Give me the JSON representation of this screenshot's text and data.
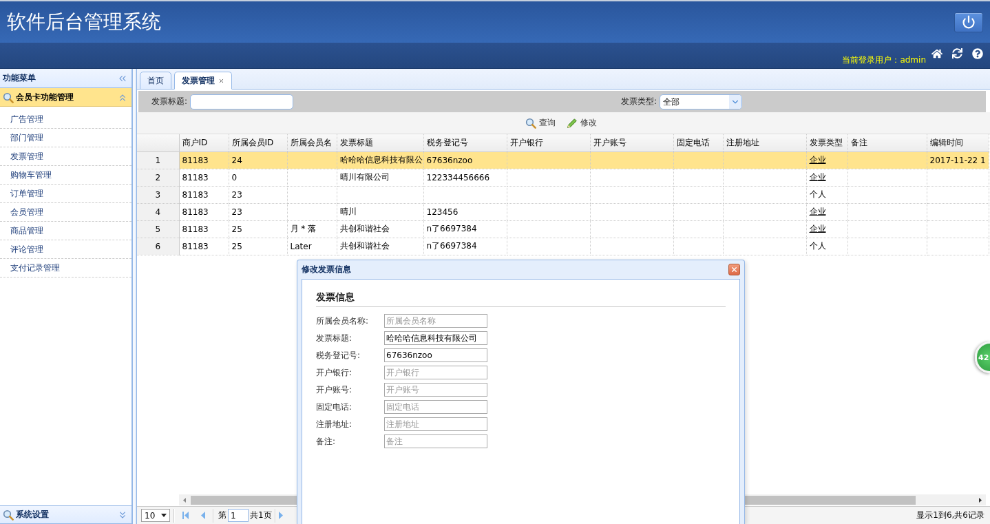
{
  "header": {
    "title": "软件后台管理系统",
    "user_label": "当前登录用户：admin"
  },
  "sidebar": {
    "title": "功能菜单",
    "panels": [
      {
        "title": "会员卡功能管理",
        "expanded": true,
        "items": [
          "广告管理",
          "部门管理",
          "发票管理",
          "购物车管理",
          "订单管理",
          "会员管理",
          "商品管理",
          "评论管理",
          "支付记录管理"
        ]
      },
      {
        "title": "系统设置",
        "expanded": false
      }
    ]
  },
  "tabs": [
    {
      "label": "首页",
      "selected": false,
      "closable": false
    },
    {
      "label": "发票管理",
      "selected": true,
      "closable": true
    }
  ],
  "filters": [
    {
      "kind": "input",
      "label": "发票标题:"
    },
    {
      "kind": "select",
      "label": "发票类型:",
      "value": "全部"
    }
  ],
  "toolbar": [
    "查询",
    "修改"
  ],
  "table": {
    "columns": [
      {
        "label": "商户ID"
      },
      {
        "label": "所属会员ID"
      },
      {
        "label": "所属会员名"
      },
      {
        "label": "发票标题"
      },
      {
        "label": "税务登记号"
      },
      {
        "label": "开户银行"
      },
      {
        "label": "开户账号"
      },
      {
        "label": "固定电话"
      },
      {
        "label": "注册地址"
      },
      {
        "label": "发票类型",
        "kind": "link"
      },
      {
        "label": "备注"
      },
      {
        "label": "编辑时间"
      }
    ],
    "rows": [
      {
        "number": "1",
        "selected": true,
        "type_linked": true,
        "cells": [
          "81183",
          "24",
          null,
          "哈哈哈信息科技有限公",
          "67636nzoo",
          null,
          null,
          null,
          null,
          "企业",
          null,
          "2017-11-22 1"
        ]
      },
      {
        "number": "2",
        "selected": false,
        "type_linked": true,
        "cells": [
          "81183",
          "0",
          null,
          "晴川有限公司",
          "122334456666",
          null,
          null,
          null,
          null,
          "企业",
          null,
          null
        ]
      },
      {
        "number": "3",
        "selected": false,
        "type_linked": false,
        "cells": [
          "81183",
          "23",
          null,
          null,
          null,
          null,
          null,
          null,
          null,
          "个人",
          null,
          null
        ]
      },
      {
        "number": "4",
        "selected": false,
        "type_linked": true,
        "cells": [
          "81183",
          "23",
          null,
          "晴川",
          "123456",
          null,
          null,
          null,
          null,
          "企业",
          null,
          null
        ]
      },
      {
        "number": "5",
        "selected": false,
        "type_linked": true,
        "cells": [
          "81183",
          "25",
          "月 * 落",
          "共创和谐社会",
          "n了6697384",
          null,
          null,
          null,
          null,
          "企业",
          null,
          null
        ]
      },
      {
        "number": "6",
        "selected": false,
        "type_linked": false,
        "cells": [
          "81183",
          "25",
          "Later",
          "共创和谐社会",
          "n了6697384",
          null,
          null,
          null,
          null,
          "个人",
          null,
          null
        ]
      }
    ]
  },
  "pagination": {
    "page_size": "10",
    "page_prefix": "第",
    "page": "1",
    "page_suffix": "共1页",
    "summary": "显示1到6,共6记录"
  },
  "dialog": {
    "title": "修改发票信息",
    "section": "发票信息",
    "fields": [
      {
        "label": "所属会员名称:",
        "placeholder": "所属会员名称"
      },
      {
        "label": "发票标题:",
        "value": "哈哈哈信息科技有限公司"
      },
      {
        "label": "税务登记号:",
        "value": "67636nzoo"
      },
      {
        "label": "开户银行:",
        "placeholder": "开户银行"
      },
      {
        "label": "开户账号:",
        "placeholder": "开户账号"
      },
      {
        "label": "固定电话:",
        "placeholder": "固定电话"
      },
      {
        "label": "注册地址:",
        "placeholder": "注册地址"
      },
      {
        "label": "备注:",
        "placeholder": "备注"
      }
    ]
  },
  "floating_badge": {
    "text": "42"
  }
}
